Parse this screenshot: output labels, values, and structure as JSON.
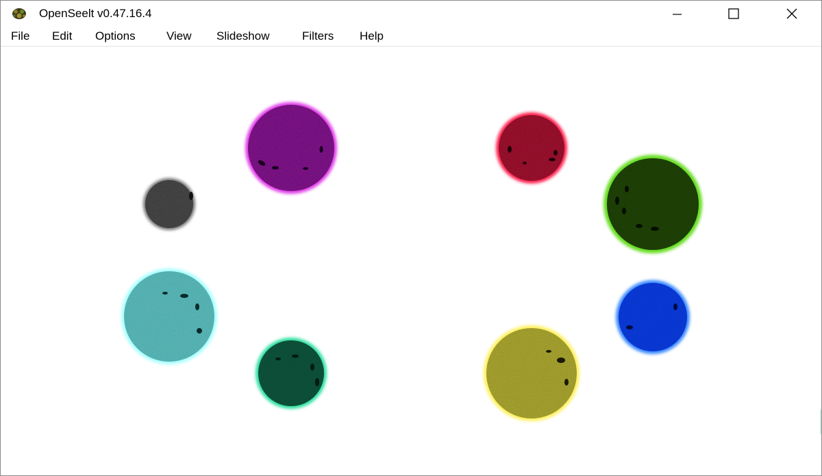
{
  "window": {
    "title": "OpenSeelt v0.47.16.4",
    "icon": "app-icon",
    "controls": [
      "minimize-icon",
      "maximize-icon",
      "close-icon"
    ]
  },
  "menu": {
    "items": [
      {
        "label": "File"
      },
      {
        "label": "Edit"
      },
      {
        "label": "Options"
      },
      {
        "label": "View"
      },
      {
        "label": "Slideshow"
      },
      {
        "label": "Filters"
      },
      {
        "label": "Help"
      }
    ]
  },
  "image": {
    "background": "#ffffff",
    "spheres": [
      {
        "name": "purple-sphere",
        "fill": "#6e0a78",
        "glow": "#e040e8"
      },
      {
        "name": "red-sphere",
        "fill": "#8a0a25",
        "glow": "#ff2050"
      },
      {
        "name": "gray-sphere",
        "fill": "#3a3a3a",
        "glow": "#777777"
      },
      {
        "name": "green-sphere",
        "fill": "#1a3a05",
        "glow": "#66dd22"
      },
      {
        "name": "cyan-sphere",
        "fill": "#5ab8b8",
        "glow": "#a8ffff"
      },
      {
        "name": "blue-sphere",
        "fill": "#0a3ad8",
        "glow": "#3a8aff"
      },
      {
        "name": "teal-sphere",
        "fill": "#0a4a35",
        "glow": "#2ee0a0"
      },
      {
        "name": "yellow-sphere",
        "fill": "#a8a430",
        "glow": "#fff060"
      }
    ]
  }
}
